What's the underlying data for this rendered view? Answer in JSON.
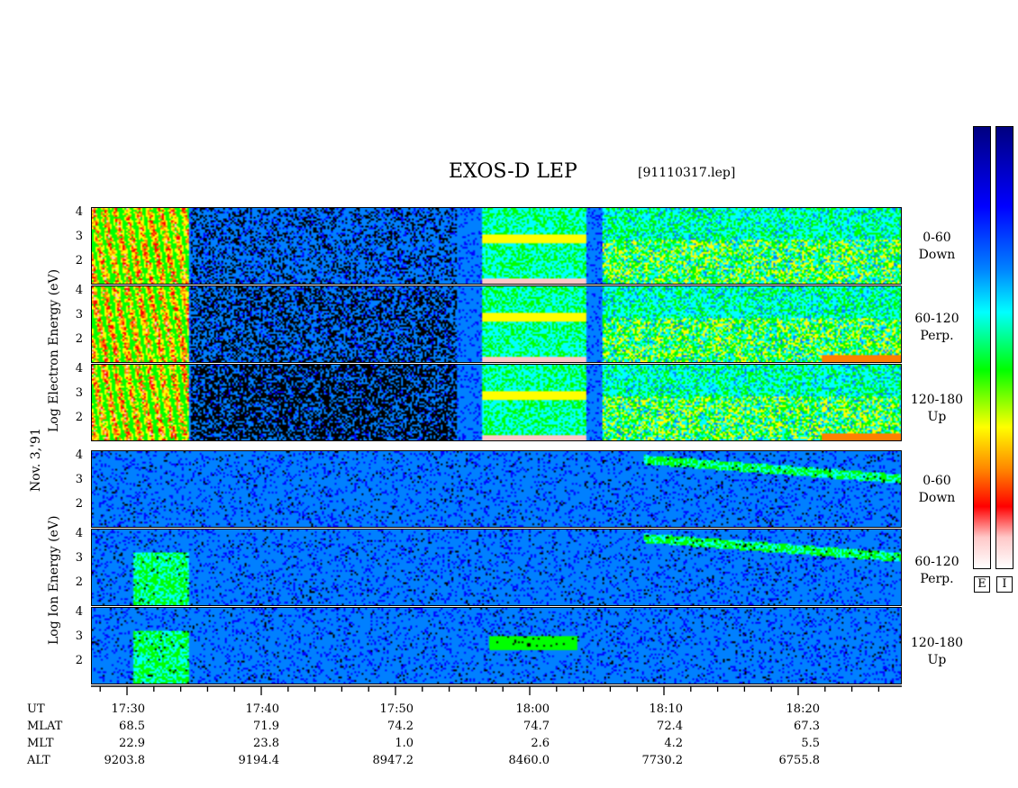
{
  "header": {
    "title": "EXOS-D LEP",
    "filename": "[91110317.lep]"
  },
  "left_labels": {
    "electron": "Log Electron Energy (eV)",
    "date": "Nov. 3,'91",
    "ion": "Log Ion Energy (eV)"
  },
  "panels": [
    {
      "group": "electron",
      "range": "0-60",
      "dir": "Down"
    },
    {
      "group": "electron",
      "range": "60-120",
      "dir": "Perp."
    },
    {
      "group": "electron",
      "range": "120-180",
      "dir": "Up"
    },
    {
      "group": "ion",
      "range": "0-60",
      "dir": "Down"
    },
    {
      "group": "ion",
      "range": "60-120",
      "dir": "Perp."
    },
    {
      "group": "ion",
      "range": "120-180",
      "dir": "Up"
    }
  ],
  "yticks": [
    "4",
    "3",
    "2"
  ],
  "colorbars": {
    "e_label": "E",
    "i_label": "I"
  },
  "colors": [
    "#ffffff",
    "#ffc8c8",
    "#ff0000",
    "#ff8000",
    "#ffff00",
    "#00ff00",
    "#00ffff",
    "#0080ff",
    "#0000ff",
    "#000080"
  ],
  "time_axis": {
    "rows": [
      "UT",
      "MLAT",
      "MLT",
      "ALT"
    ],
    "columns": [
      {
        "UT": "17:30",
        "MLAT": "68.5",
        "MLT": "22.9",
        "ALT": "9203.8"
      },
      {
        "UT": "17:40",
        "MLAT": "71.9",
        "MLT": "23.8",
        "ALT": "9194.4"
      },
      {
        "UT": "17:50",
        "MLAT": "74.2",
        "MLT": "1.0",
        "ALT": "8947.2"
      },
      {
        "UT": "18:00",
        "MLAT": "74.7",
        "MLT": "2.6",
        "ALT": "8460.0"
      },
      {
        "UT": "18:10",
        "MLAT": "72.4",
        "MLT": "4.2",
        "ALT": "7730.2"
      },
      {
        "UT": "18:20",
        "MLAT": "67.3",
        "MLT": "5.5",
        "ALT": "6755.8"
      }
    ]
  },
  "chart_data": {
    "type": "heatmap",
    "title": "EXOS-D LEP",
    "ylabel": "Log Energy (eV)",
    "ylim": [
      1,
      4
    ],
    "x_ticks": [
      "17:30",
      "17:40",
      "17:50",
      "18:00",
      "18:10",
      "18:20"
    ],
    "series": [
      {
        "name": "Electron 0-60 Down"
      },
      {
        "name": "Electron 60-120 Perp."
      },
      {
        "name": "Electron 120-180 Up"
      },
      {
        "name": "Ion 0-60 Down"
      },
      {
        "name": "Ion 60-120 Perp."
      },
      {
        "name": "Ion 120-180 Up"
      }
    ]
  }
}
